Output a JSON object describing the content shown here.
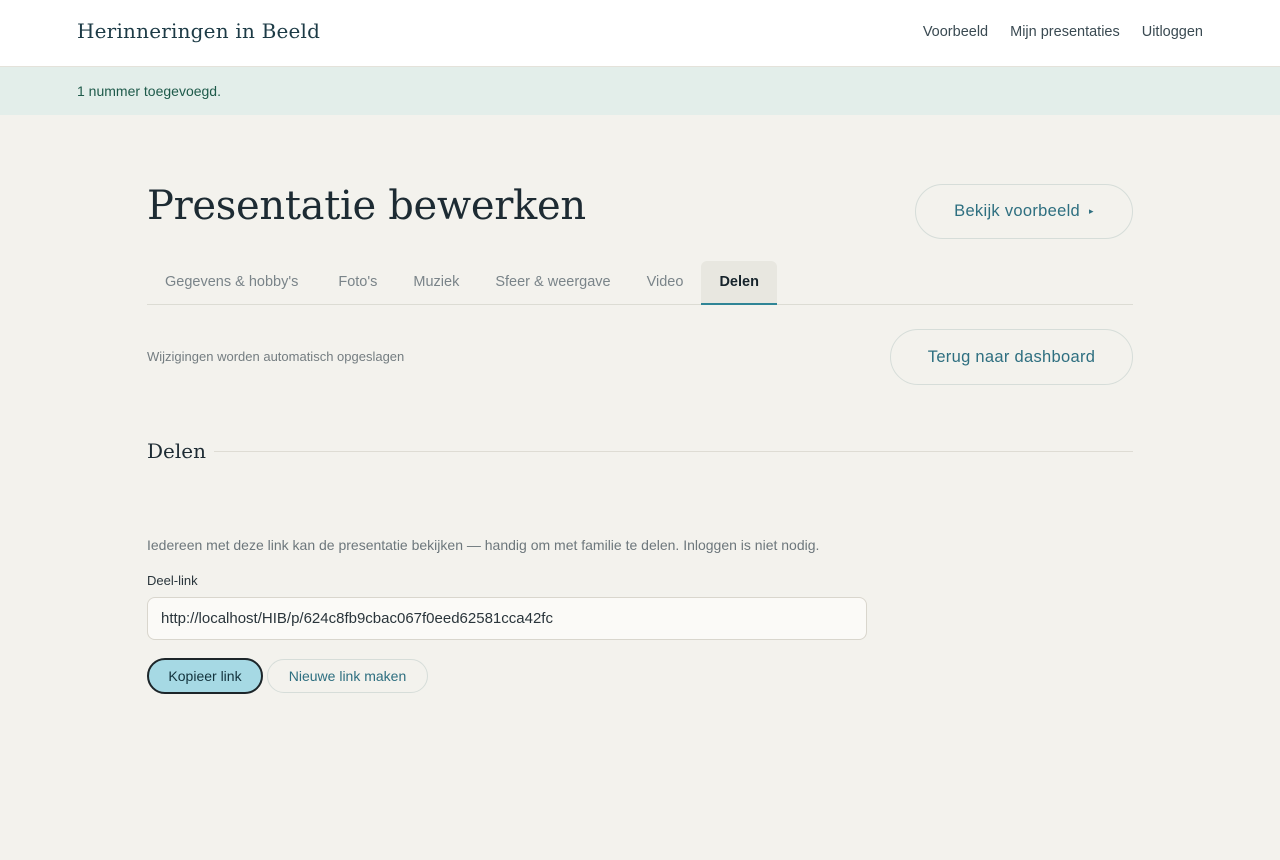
{
  "app": {
    "brand": "Herinneringen in Beeld",
    "nav": [
      {
        "label": "Voorbeeld"
      },
      {
        "label": "Mijn presentaties"
      },
      {
        "label": "Uitloggen"
      }
    ]
  },
  "flash": {
    "message": "1 nummer toegevoegd."
  },
  "header": {
    "title": "Presentatie bewerken",
    "preview_button": "Bekijk voorbeeld",
    "preview_arrow": "▸"
  },
  "tabs": [
    {
      "label": "Gegevens & hobby's",
      "active": false
    },
    {
      "label": "Foto's",
      "active": false
    },
    {
      "label": "Muziek",
      "active": false
    },
    {
      "label": "Sfeer & weergave",
      "active": false
    },
    {
      "label": "Video",
      "active": false
    },
    {
      "label": "Delen",
      "active": true
    }
  ],
  "status": {
    "autosave_text": "Wijzigingen worden automatisch opgeslagen",
    "back_button": "Terug naar dashboard"
  },
  "share": {
    "heading": "Delen",
    "intro": "Iedereen met deze link kan de presentatie bekijken — handig om met familie te delen. Inloggen is niet nodig.",
    "link_label": "Deel-link",
    "link_value": "http://localhost/HIB/p/624c8fb9cbac067f0eed62581cca42fc",
    "copy_button": "Kopieer link",
    "new_link_button": "Nieuwe link maken"
  },
  "colors": {
    "accent": "#2e6f80",
    "flash_bg": "#e3eeea",
    "copy_button_bg": "#a6d9e4",
    "page_bg": "#f3f2ed"
  }
}
